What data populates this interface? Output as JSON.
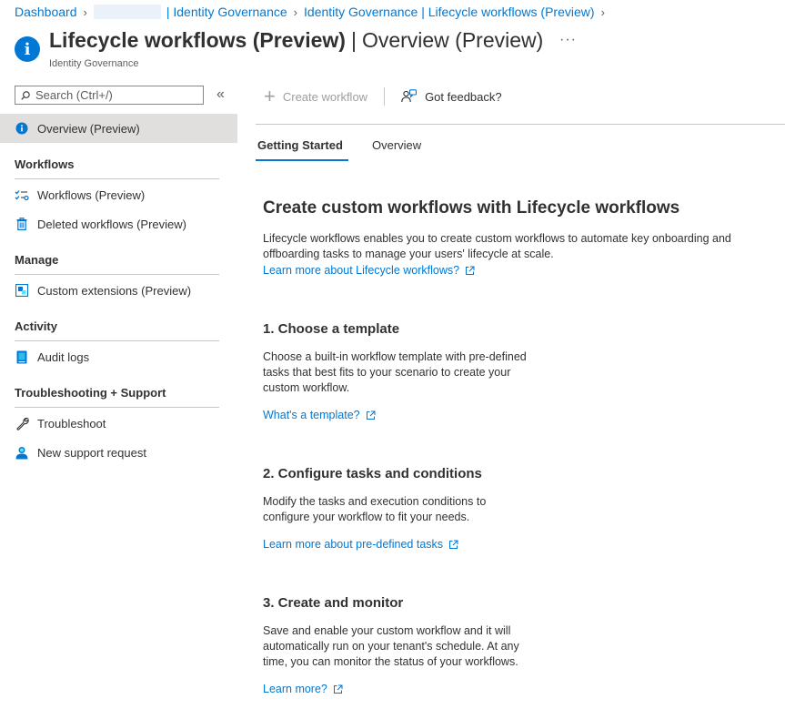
{
  "breadcrumb": {
    "items": [
      "Dashboard",
      "| Identity Governance",
      "Identity Governance | Lifecycle workflows (Preview)"
    ]
  },
  "header": {
    "title_main": "Lifecycle workflows (Preview)",
    "title_separator": "|",
    "title_section": "Overview (Preview)",
    "subtitle": "Identity Governance",
    "more": "···"
  },
  "sidebar": {
    "search_placeholder": "Search (Ctrl+/)",
    "collapse": "«",
    "top_item": "Overview (Preview)",
    "sections": [
      {
        "title": "Workflows",
        "items": [
          "Workflows (Preview)",
          "Deleted workflows (Preview)"
        ]
      },
      {
        "title": "Manage",
        "items": [
          "Custom extensions (Preview)"
        ]
      },
      {
        "title": "Activity",
        "items": [
          "Audit logs"
        ]
      },
      {
        "title": "Troubleshooting + Support",
        "items": [
          "Troubleshoot",
          "New support request"
        ]
      }
    ]
  },
  "toolbar": {
    "create_label": "Create workflow",
    "feedback_label": "Got feedback?"
  },
  "tabs": [
    "Getting Started",
    "Overview"
  ],
  "main": {
    "heading": "Create custom workflows with Lifecycle workflows",
    "intro": "Lifecycle workflows enables you to create custom workflows to automate key onboarding and offboarding tasks to manage your users' lifecycle at scale.",
    "intro_link": "Learn more about Lifecycle workflows?",
    "steps": [
      {
        "title": "1. Choose a template",
        "text": "Choose a built-in workflow template with pre-defined tasks that best fits to your scenario to create your custom workflow.",
        "link": "What's a template?"
      },
      {
        "title": "2. Configure tasks and conditions",
        "text": "Modify the tasks and execution conditions to configure your workflow to fit your needs.",
        "link": "Learn more about pre-defined tasks"
      },
      {
        "title": "3. Create and monitor",
        "text": "Save and enable your custom workflow and it will automatically run on your tenant's schedule. At any time, you can monitor the status of your workflows.",
        "link": "Learn more?"
      }
    ]
  },
  "colors": {
    "accent": "#0078d4",
    "text": "#323130",
    "muted": "#605e5c",
    "active_bg": "#e1dfdd"
  }
}
